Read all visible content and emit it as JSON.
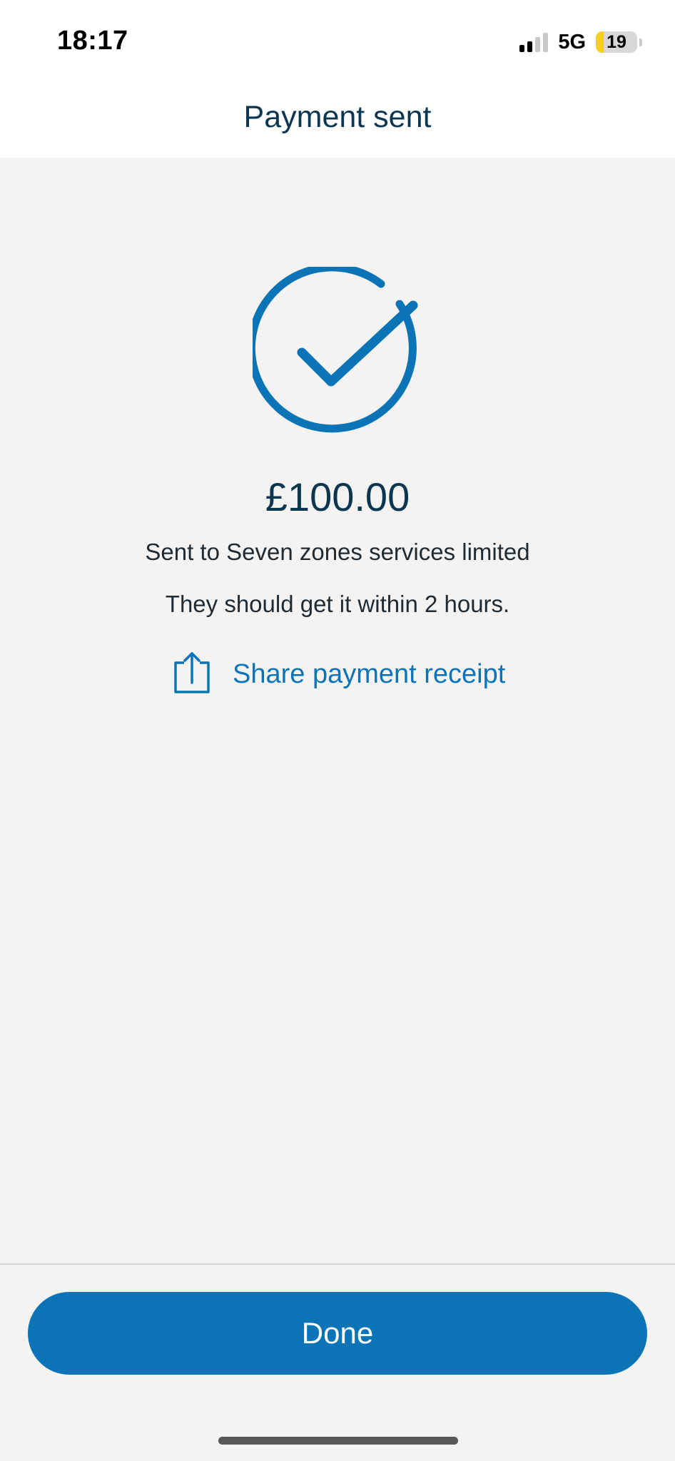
{
  "status_bar": {
    "time": "18:17",
    "network": "5G",
    "battery_level": "19",
    "battery_fraction": 0.19,
    "signal_bars_active": 2,
    "signal_bars_total": 4
  },
  "header": {
    "title": "Payment sent"
  },
  "confirmation": {
    "icon": "check-circle-icon",
    "amount": "£100.00",
    "recipient_text": "Sent to Seven zones services limited",
    "eta_text": "They should get it within 2 hours."
  },
  "share": {
    "icon": "share-icon",
    "label": "Share payment receipt"
  },
  "footer": {
    "done_label": "Done"
  },
  "colors": {
    "accent": "#0a74b7",
    "title_text": "#0b3652",
    "background": "#f4f3f2",
    "battery_low": "#f7cf1f"
  }
}
